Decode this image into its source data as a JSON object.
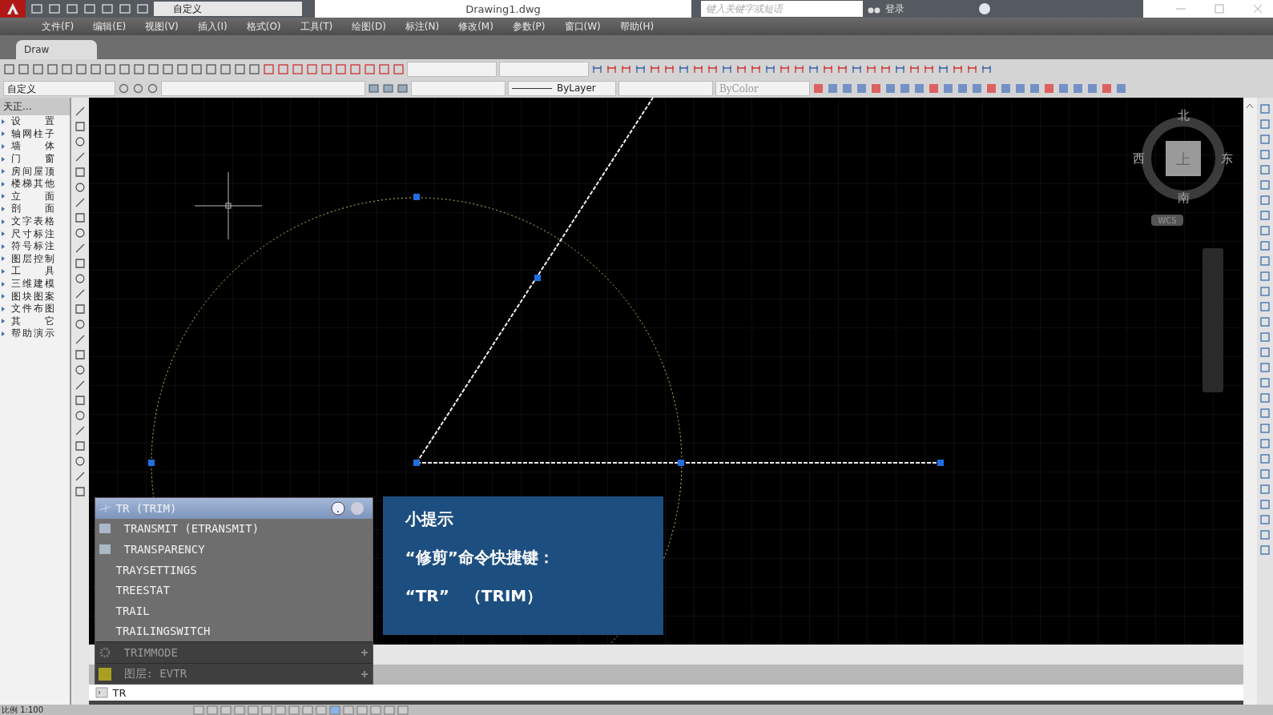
{
  "title_bar": {
    "workspace": "自定义",
    "title": "Drawing1.dwg",
    "search_placeholder": "键入关键字或短语",
    "user": "登录"
  },
  "menu": [
    "文件(F)",
    "编辑(E)",
    "视图(V)",
    "插入(I)",
    "格式(O)",
    "工具(T)",
    "绘图(D)",
    "标注(N)",
    "修改(M)",
    "参数(P)",
    "窗口(W)",
    "帮助(H)"
  ],
  "tabs": [
    {
      "label": "Draw",
      "selected": true
    }
  ],
  "toolbar": {
    "layer_preset": "自定义",
    "linetype": "ByLayer",
    "plot_style": "ByColor"
  },
  "side_panel": {
    "title": "天正...",
    "items": [
      "设 置",
      "轴网柱子",
      "墙 体",
      "门 窗",
      "房间屋顶",
      "楼梯其他",
      "立 面",
      "剖 面",
      "文字表格",
      "尺寸标注",
      "符号标注",
      "图层控制",
      "工 具",
      "三维建模",
      "图块图案",
      "文件布图",
      "其 它",
      "帮助演示"
    ]
  },
  "viewcube": {
    "north": "北",
    "south": "南",
    "west": "西",
    "east": "东",
    "face": "上",
    "ucs": "WCS"
  },
  "autocomplete": [
    {
      "kind": "command",
      "label": "TR (TRIM)",
      "selected": true
    },
    {
      "kind": "command",
      "label": "TRANSMIT (ETRANSMIT)",
      "selected": false
    },
    {
      "kind": "command",
      "label": "TRANSPARENCY",
      "selected": false
    },
    {
      "kind": "command",
      "label": "TRAYSETTINGS",
      "selected": false
    },
    {
      "kind": "command",
      "label": "TREESTAT",
      "selected": false
    },
    {
      "kind": "command",
      "label": "TRAIL",
      "selected": false
    },
    {
      "kind": "command",
      "label": "TRAILINGSWITCH",
      "selected": false
    },
    {
      "kind": "sysvar",
      "label": "TRIMMODE",
      "selected": false
    },
    {
      "kind": "layer",
      "label": "图层: EVTR",
      "selected": false
    }
  ],
  "tip": {
    "title": "小提示",
    "lines": [
      "“修剪”命令快捷键：",
      "“TR”　（TRIM）"
    ]
  },
  "command_line": {
    "value": "TR"
  },
  "status_bar": {
    "scale": "比例 1:100"
  }
}
